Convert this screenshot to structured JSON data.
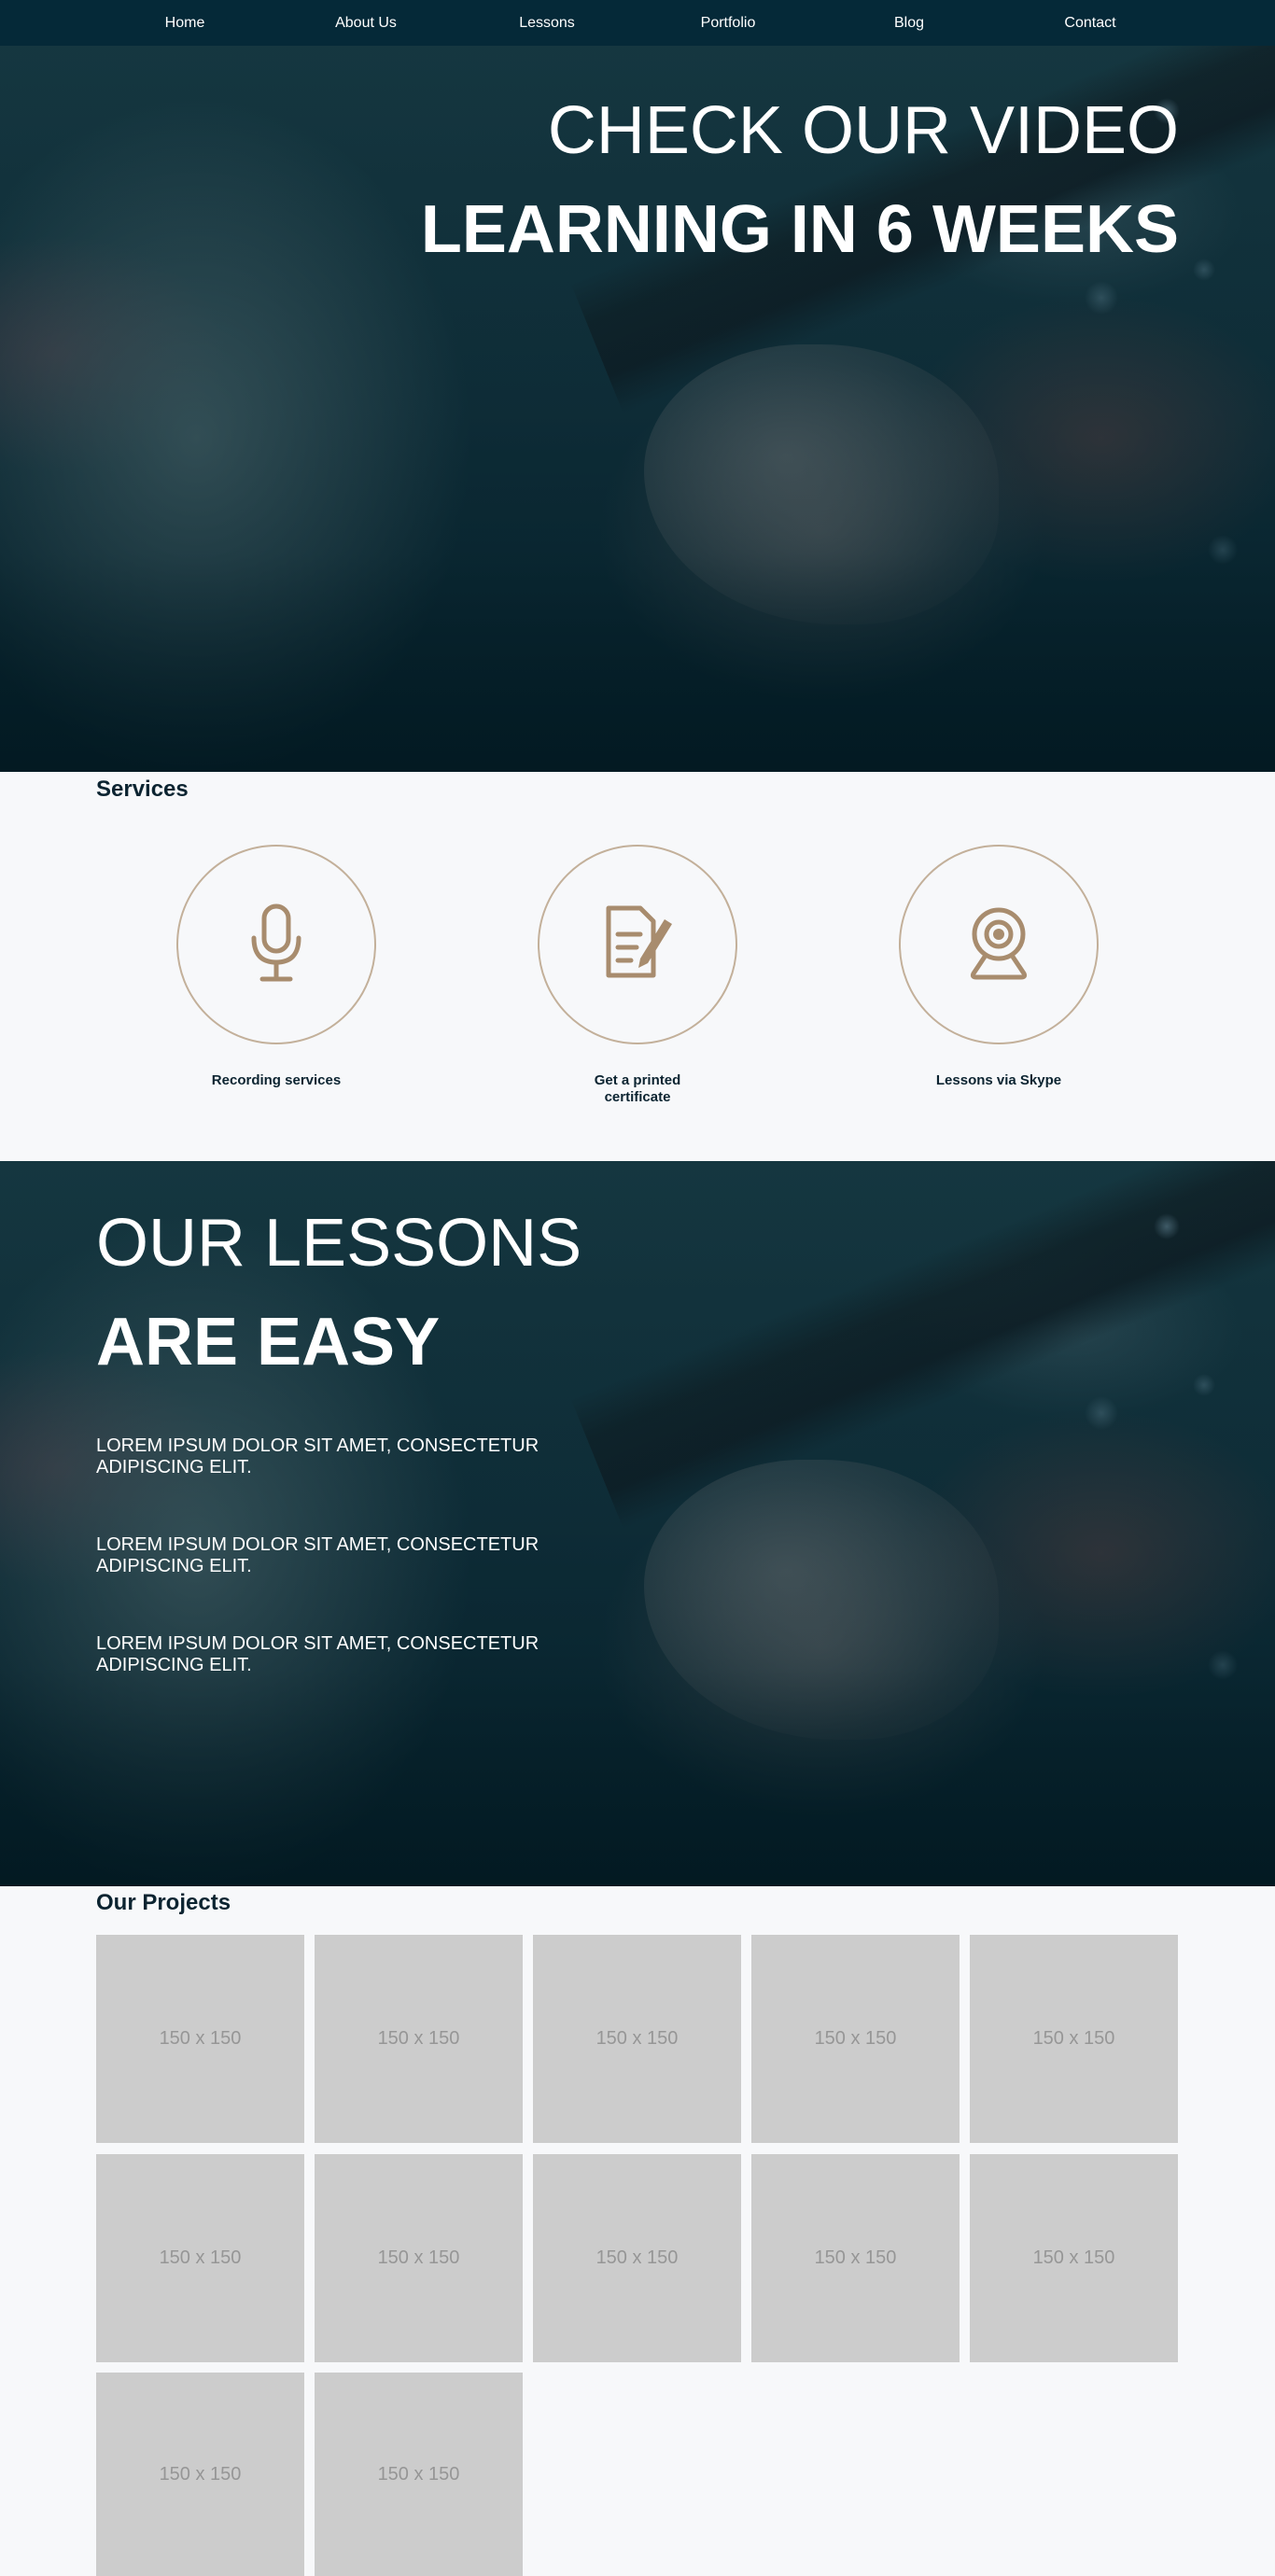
{
  "nav": {
    "items": [
      {
        "label": "Home"
      },
      {
        "label": "About Us"
      },
      {
        "label": "Lessons"
      },
      {
        "label": "Portfolio"
      },
      {
        "label": "Blog"
      },
      {
        "label": "Contact"
      }
    ]
  },
  "hero": {
    "line1": "CHECK OUR VIDEO",
    "line2": "LEARNING IN 6 WEEKS"
  },
  "services": {
    "title": "Services",
    "items": [
      {
        "label": "Recording services",
        "icon": "microphone-icon"
      },
      {
        "label": "Get a printed certificate",
        "icon": "certificate-icon"
      },
      {
        "label": "Lessons via Skype",
        "icon": "webcam-icon"
      }
    ],
    "icon_color": "#a88c6e",
    "circle_color": "#c3b09a"
  },
  "lessons": {
    "line1": "OUR LESSONS",
    "line2": "ARE EASY",
    "paragraphs": [
      "LOREM IPSUM DOLOR SIT AMET, CONSECTETUR ADIPISCING ELIT.",
      "LOREM IPSUM DOLOR SIT AMET, CONSECTETUR ADIPISCING ELIT.",
      "LOREM IPSUM DOLOR SIT AMET, CONSECTETUR ADIPISCING ELIT."
    ]
  },
  "projects": {
    "title": "Our Projects",
    "tiles": [
      "150 x 150",
      "150 x 150",
      "150 x 150",
      "150 x 150",
      "150 x 150",
      "150 x 150",
      "150 x 150",
      "150 x 150",
      "150 x 150",
      "150 x 150",
      "150 x 150",
      "150 x 150"
    ]
  },
  "colors": {
    "nav_bg": "#052938",
    "page_bg": "#f7f8fa",
    "title_text": "#0c2431",
    "placeholder_bg": "#cccccc",
    "placeholder_text": "#969696"
  }
}
